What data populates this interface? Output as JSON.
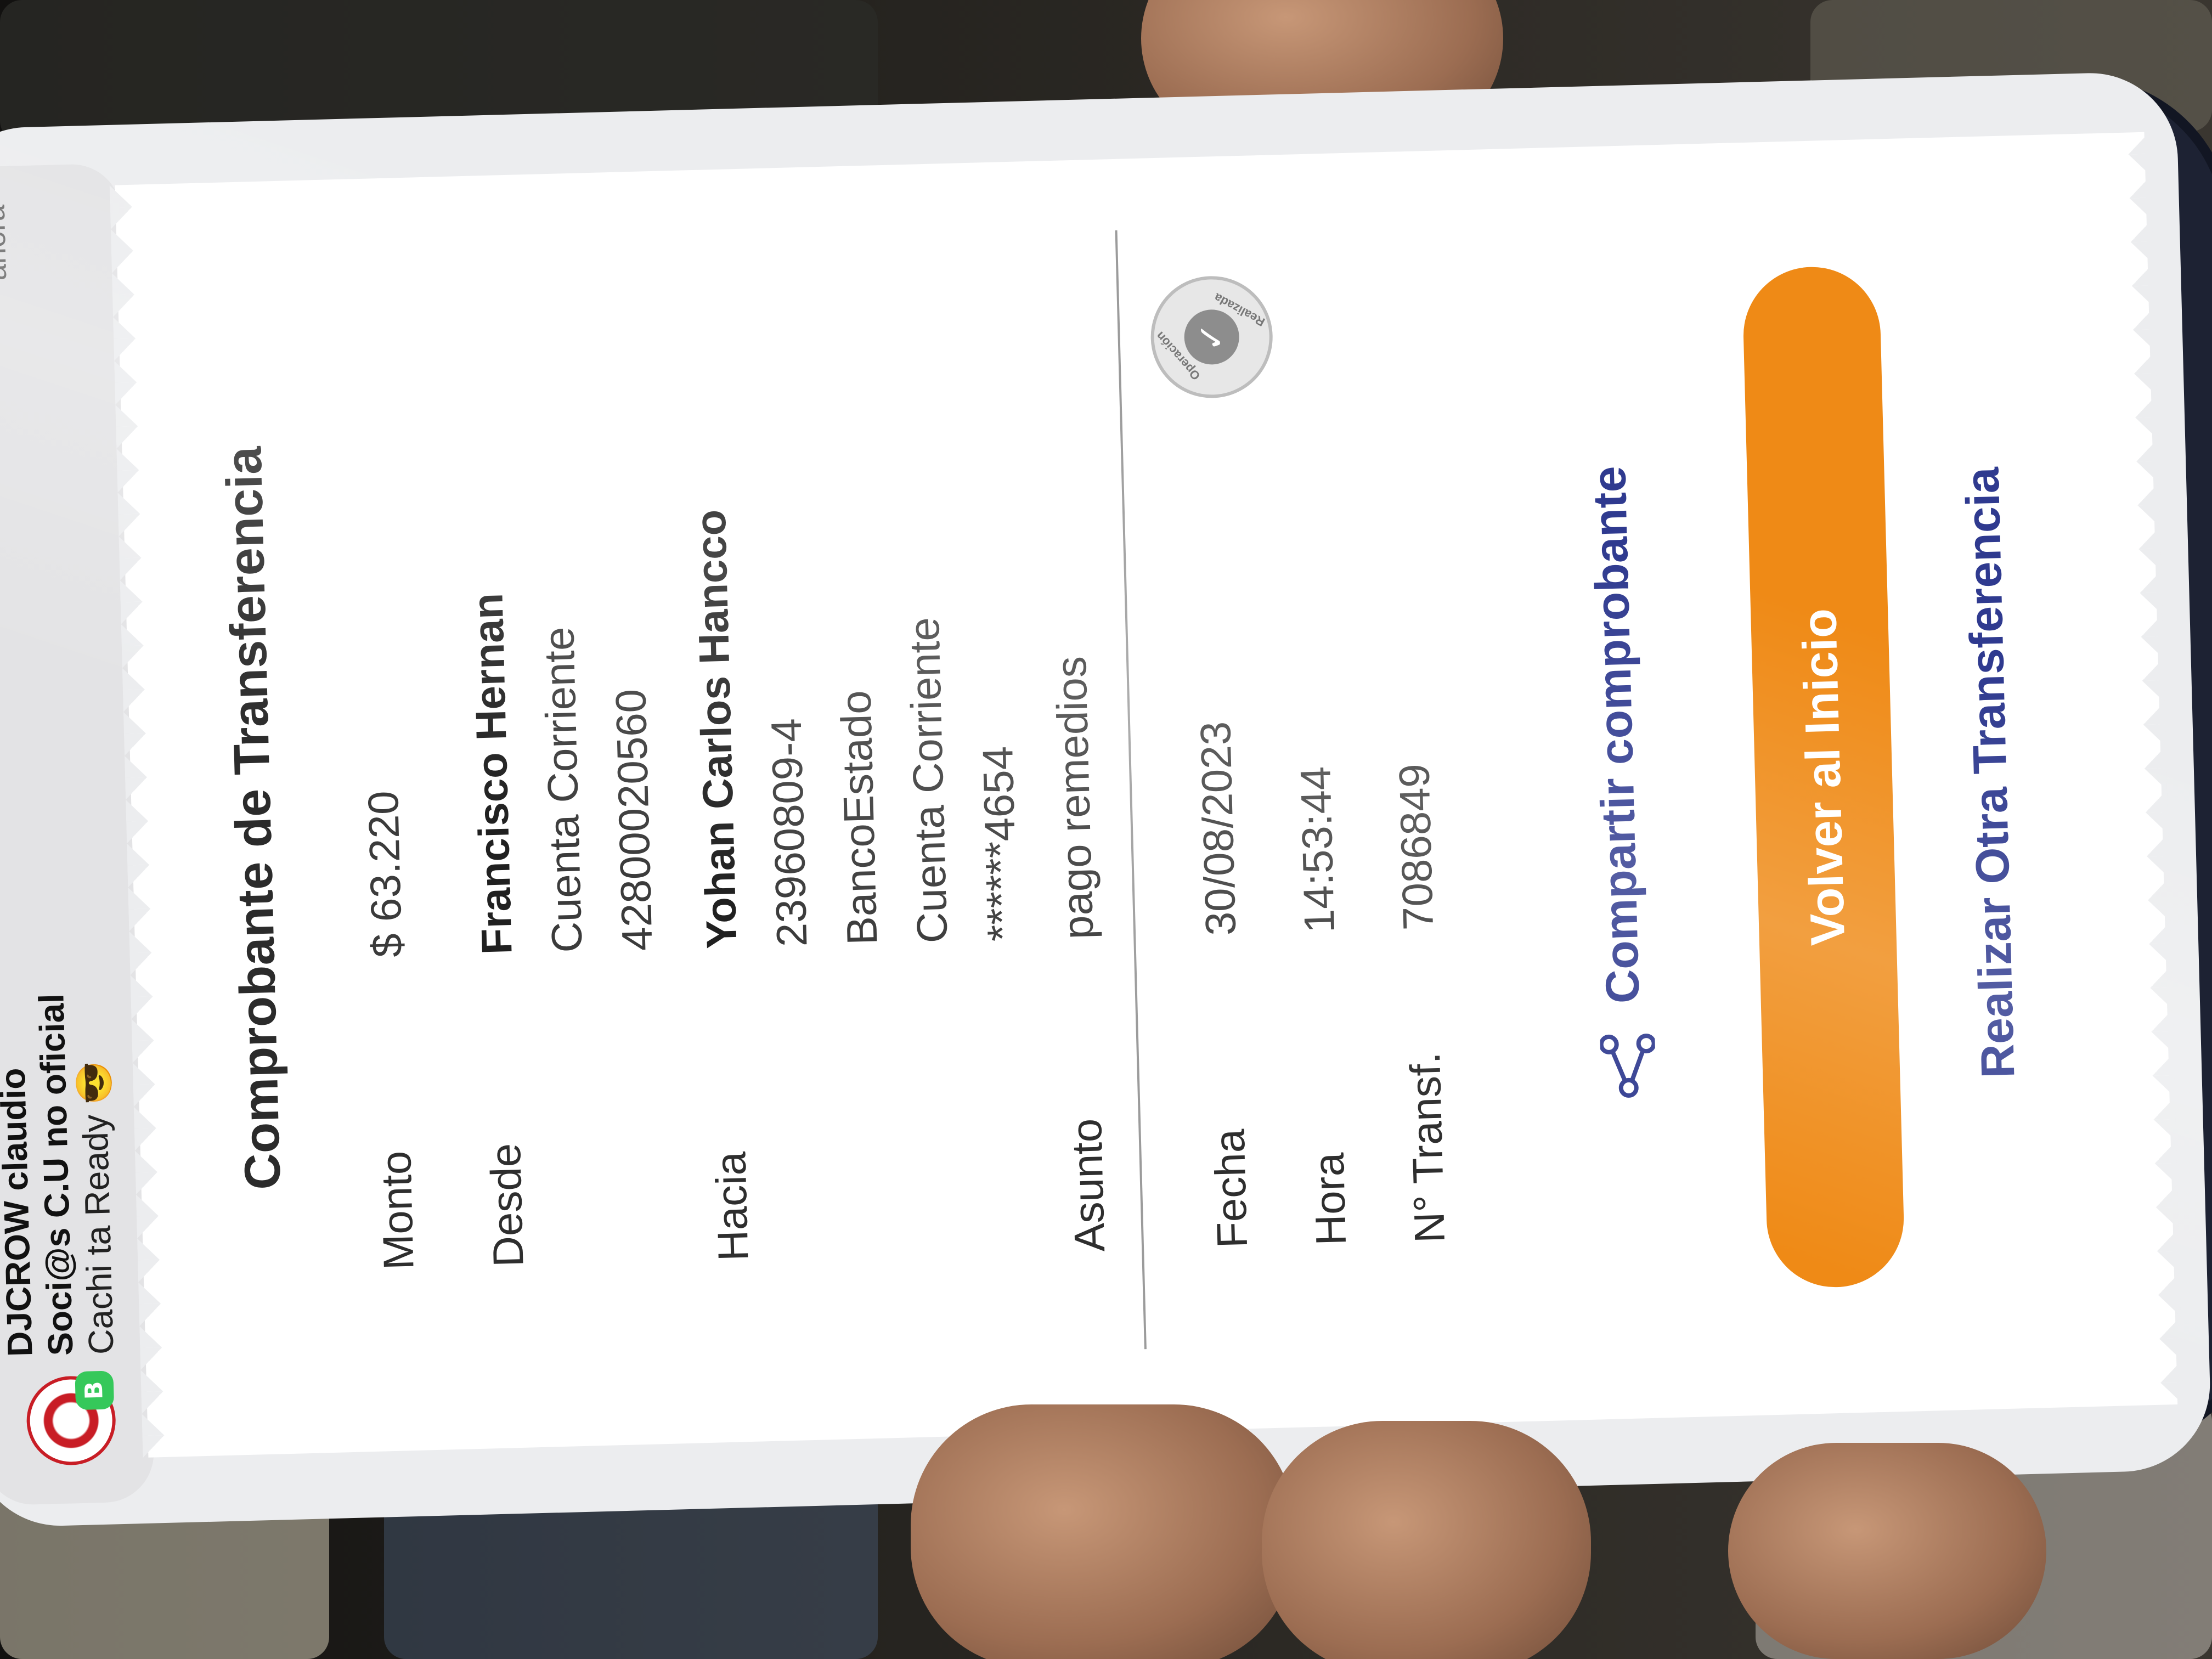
{
  "notification": {
    "line1": "DJCROW  claudio",
    "line2": "Soci@s C.U no oficial",
    "line3": "Cachi ta Ready 😎",
    "time": "ahora",
    "app_badge": "B"
  },
  "receipt": {
    "title": "Comprobante de Transferencia",
    "monto_label": "Monto",
    "monto_value": "$ 63.220",
    "desde_label": "Desde",
    "desde_name": "Francisco Hernan",
    "desde_account_type": "Cuenta Corriente",
    "desde_account_number": "42800020560",
    "hacia_label": "Hacia",
    "hacia_name": "Yohan Carlos Hancco",
    "hacia_rut": "23960809-4",
    "hacia_bank": "BancoEstado",
    "hacia_account_type": "Cuenta Corriente",
    "hacia_account_number": "******4654",
    "asunto_label": "Asunto",
    "asunto_value": "pago remedios",
    "fecha_label": "Fecha",
    "fecha_value": "30/08/2023",
    "hora_label": "Hora",
    "hora_value": "14:53:44",
    "transf_label": "N° Transf.",
    "transf_value": "7086849",
    "stamp_top": "Operación",
    "stamp_bottom": "Realizada"
  },
  "actions": {
    "share_label": "Compartir comprobante",
    "home_button": "Volver al Inicio",
    "other_transfer": "Realizar Otra Transferencia"
  },
  "colors": {
    "accent_orange": "#ef8a16",
    "link_blue": "#2f3a8f",
    "card_white": "#ffffff"
  },
  "icons": {
    "share": "share-icon",
    "stamp": "stamp-icon",
    "whatsapp_badge": "whatsapp-badge-icon"
  }
}
